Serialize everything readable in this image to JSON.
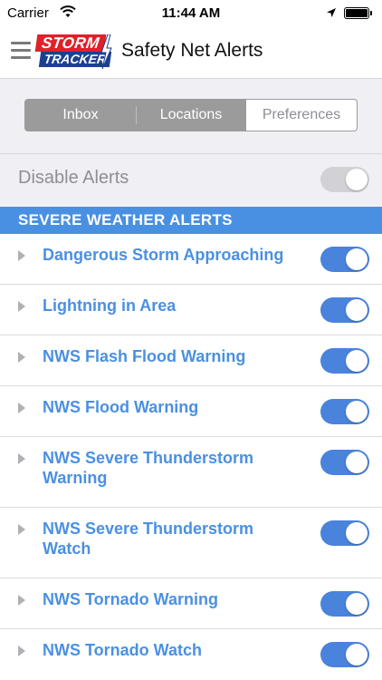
{
  "status_bar": {
    "carrier": "Carrier",
    "time": "11:44 AM",
    "wifi_icon": "wifi-icon",
    "location_icon": "location-arrow-icon",
    "battery_level": 0.95
  },
  "navbar": {
    "menu_icon": "hamburger-menu-icon",
    "logo_top": "STORM",
    "logo_bottom": "TRACKER",
    "title": "Safety Net Alerts"
  },
  "segments": [
    {
      "label": "Inbox",
      "active": false
    },
    {
      "label": "Locations",
      "active": false
    },
    {
      "label": "Preferences",
      "active": true
    }
  ],
  "disable_alerts": {
    "label": "Disable Alerts",
    "enabled": false
  },
  "section": {
    "title": "SEVERE WEATHER ALERTS"
  },
  "alerts": [
    {
      "label": "Dangerous Storm Approaching",
      "on": true
    },
    {
      "label": "Lightning in Area",
      "on": true
    },
    {
      "label": "NWS Flash Flood Warning",
      "on": true
    },
    {
      "label": "NWS Flood Warning",
      "on": true
    },
    {
      "label": "NWS Severe Thunderstorm Warning",
      "on": true
    },
    {
      "label": "NWS Severe Thunderstorm Watch",
      "on": true
    },
    {
      "label": "NWS Tornado Warning",
      "on": true
    },
    {
      "label": "NWS Tornado Watch",
      "on": true
    }
  ],
  "colors": {
    "accent": "#4a90e2",
    "toggle_on": "#4a83dc",
    "toggle_off": "#d2d2d6",
    "logo_red": "#e0202a",
    "logo_blue": "#1d3f8f"
  }
}
